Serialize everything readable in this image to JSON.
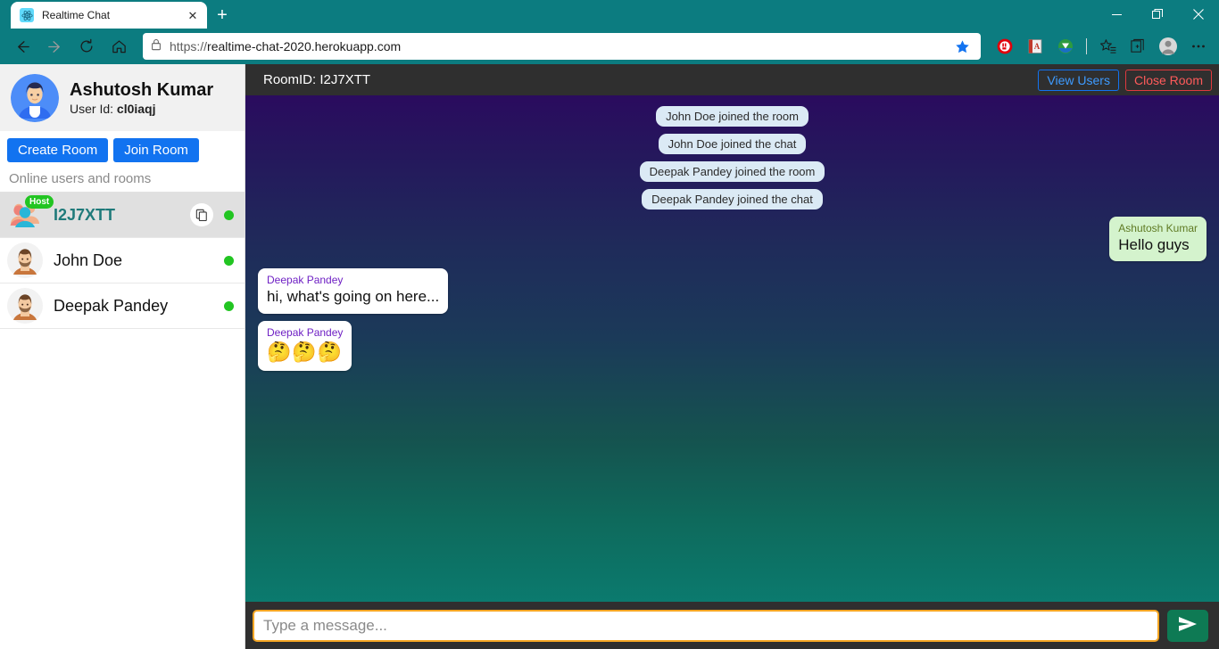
{
  "browser": {
    "tab": {
      "title": "Realtime Chat",
      "favicon_icon": "react-logo-icon",
      "close_icon": "close-icon"
    },
    "new_tab_icon": "plus-icon",
    "window_controls": {
      "minimize_icon": "minimize-icon",
      "restore_icon": "restore-icon",
      "close_icon": "window-close-icon"
    },
    "nav": {
      "back_icon": "back-arrow-icon",
      "forward_icon": "forward-arrow-icon",
      "reload_icon": "reload-icon",
      "home_icon": "home-icon"
    },
    "omnibox": {
      "lock_icon": "lock-icon",
      "scheme": "https://",
      "host": "realtime-chat-2020.herokuapp.com",
      "favorite_icon": "star-filled-icon"
    },
    "extensions": [
      {
        "name": "adblock-extension-icon"
      },
      {
        "name": "dictionary-extension-icon"
      },
      {
        "name": "download-manager-extension-icon"
      },
      {
        "name": "collections-favorites-icon"
      },
      {
        "name": "collections-icon"
      },
      {
        "name": "profile-avatar-icon"
      },
      {
        "name": "settings-more-icon"
      }
    ]
  },
  "sidebar": {
    "profile": {
      "avatar_icon": "user-avatar-icon",
      "name": "Ashutosh Kumar",
      "user_id_label": "User Id:",
      "user_id": "cl0iaqj"
    },
    "actions": {
      "create_room_label": "Create Room",
      "join_room_label": "Join Room"
    },
    "online_label": "Online users and rooms",
    "items": [
      {
        "type": "room",
        "name": "I2J7XTT",
        "badge": "Host",
        "avatar_icon": "group-users-icon",
        "copy_icon": "copy-icon",
        "status": "online"
      },
      {
        "type": "user",
        "name": "John Doe",
        "avatar_icon": "person-avatar-icon",
        "status": "online"
      },
      {
        "type": "user",
        "name": "Deepak Pandey",
        "avatar_icon": "person-avatar-icon",
        "status": "online"
      }
    ]
  },
  "chat": {
    "header": {
      "room_id_text": "RoomID: I2J7XTT",
      "view_users_label": "View Users",
      "close_room_label": "Close Room"
    },
    "messages": [
      {
        "kind": "system",
        "text": "John Doe joined the room"
      },
      {
        "kind": "system",
        "text": "John Doe joined the chat"
      },
      {
        "kind": "system",
        "text": "Deepak Pandey joined the room"
      },
      {
        "kind": "system",
        "text": "Deepak Pandey joined the chat"
      },
      {
        "kind": "outgoing",
        "sender": "Ashutosh Kumar",
        "text": "Hello guys"
      },
      {
        "kind": "incoming",
        "sender": "Deepak Pandey",
        "text": "hi, what's going on here..."
      },
      {
        "kind": "incoming",
        "sender": "Deepak Pandey",
        "text": "🤔🤔🤔",
        "is_emoji": true
      }
    ],
    "composer": {
      "placeholder": "Type a message...",
      "value": "",
      "send_icon": "send-paper-plane-icon"
    }
  },
  "colors": {
    "browser_chrome": "#0c7c80",
    "accent_blue": "#1273f0",
    "online_green": "#22c522",
    "send_green": "#0e7a54",
    "input_focus_orange": "#f5a623",
    "incoming_sender": "#6f21c4",
    "outgoing_bubble": "#d4f3cd",
    "system_pill": "#dbeaf5"
  }
}
